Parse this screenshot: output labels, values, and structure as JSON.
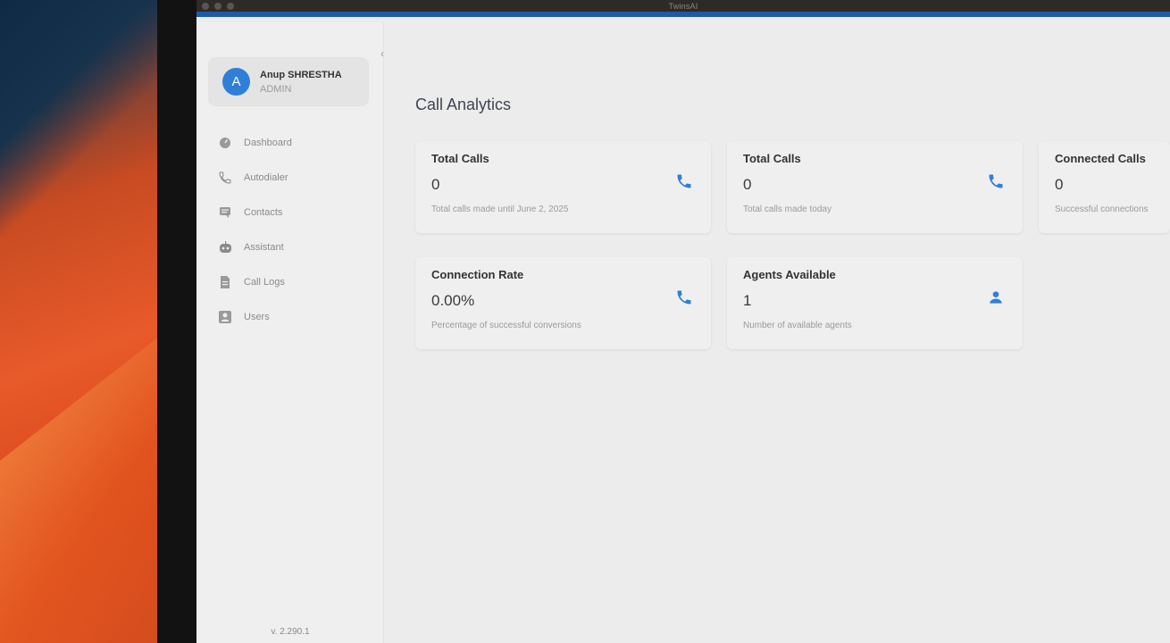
{
  "window": {
    "title": "TwinsAI"
  },
  "sidebar": {
    "profile": {
      "initial": "A",
      "name": "Anup SHRESTHA",
      "role": "ADMIN"
    },
    "items": [
      {
        "label": "Dashboard",
        "icon": "dashboard-icon"
      },
      {
        "label": "Autodialer",
        "icon": "phone-icon"
      },
      {
        "label": "Contacts",
        "icon": "contacts-icon"
      },
      {
        "label": "Assistant",
        "icon": "robot-icon"
      },
      {
        "label": "Call Logs",
        "icon": "document-icon"
      },
      {
        "label": "Users",
        "icon": "user-icon"
      }
    ],
    "version": "v. 2.290.1",
    "collapse": "‹"
  },
  "main": {
    "title": "Call Analytics",
    "cards": [
      {
        "title": "Total Calls",
        "value": "0",
        "subtitle": "Total calls made until June 2, 2025",
        "icon": "phone-icon"
      },
      {
        "title": "Total Calls",
        "value": "0",
        "subtitle": "Total calls made today",
        "icon": "phone-icon"
      },
      {
        "title": "Connected Calls",
        "value": "0",
        "subtitle": "Successful connections",
        "icon": "phone-icon"
      },
      {
        "title": "Connection Rate",
        "value": "0.00%",
        "subtitle": "Percentage of successful conversions",
        "icon": "phone-icon"
      },
      {
        "title": "Agents Available",
        "value": "1",
        "subtitle": "Number of available agents",
        "icon": "person-icon"
      }
    ]
  },
  "colors": {
    "accent": "#2f7fd8",
    "titlebar": "#2e2a27",
    "titlebar_border": "#1f5aa6"
  }
}
